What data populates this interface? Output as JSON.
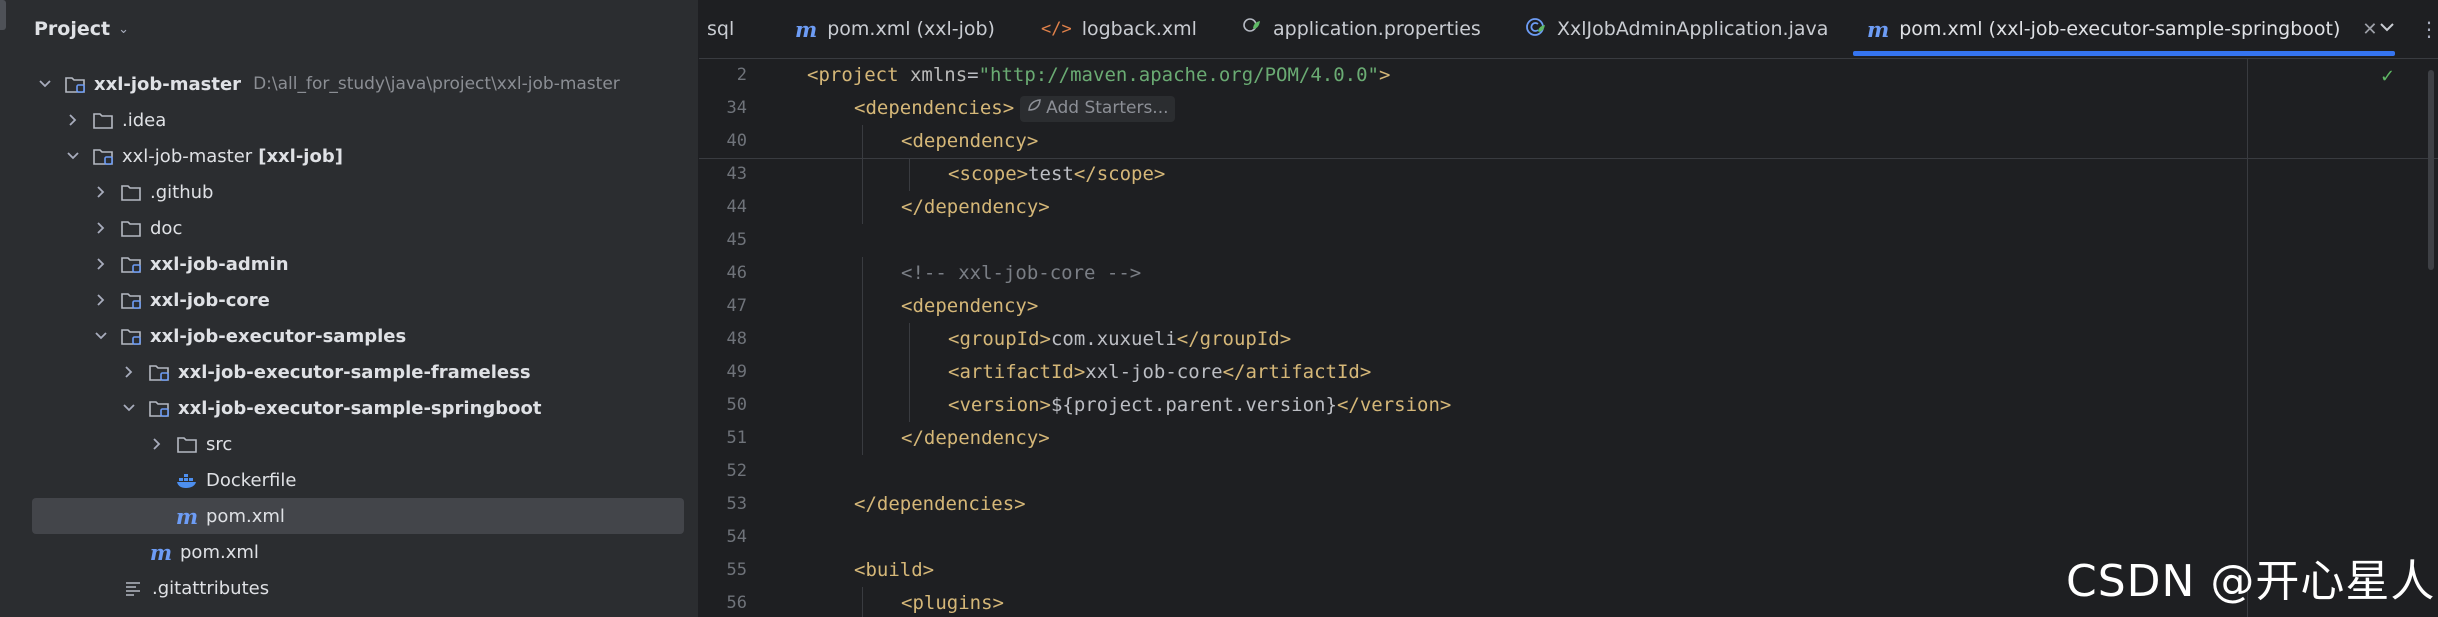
{
  "project_panel": {
    "title": "Project",
    "tree": [
      {
        "label": "xxl-job-master",
        "path": "D:\\all_for_study\\java\\project\\xxl-job-master",
        "bold": true
      },
      {
        "label": ".idea"
      },
      {
        "label": "xxl-job-master",
        "suffix": "[xxl-job]"
      },
      {
        "label": ".github"
      },
      {
        "label": "doc"
      },
      {
        "label": "xxl-job-admin",
        "bold": true
      },
      {
        "label": "xxl-job-core",
        "bold": true
      },
      {
        "label": "xxl-job-executor-samples",
        "bold": true
      },
      {
        "label": "xxl-job-executor-sample-frameless",
        "bold": true
      },
      {
        "label": "xxl-job-executor-sample-springboot",
        "bold": true
      },
      {
        "label": "src"
      },
      {
        "label": "Dockerfile"
      },
      {
        "label": "pom.xml",
        "selected": true
      },
      {
        "label": "pom.xml"
      },
      {
        "label": ".gitattributes"
      }
    ]
  },
  "tabs": [
    {
      "label": "sql"
    },
    {
      "label": "pom.xml (xxl-job)",
      "icon": "maven-icon"
    },
    {
      "label": "logback.xml",
      "icon": "xml-code-icon"
    },
    {
      "label": "application.properties",
      "icon": "spring-properties-icon"
    },
    {
      "label": "XxlJobAdminApplication.java",
      "icon": "spring-java-class-icon"
    },
    {
      "label": "pom.xml (xxl-job-executor-sample-springboot)",
      "icon": "maven-icon",
      "active": true
    }
  ],
  "editor": {
    "hint_label": "Add Starters...",
    "lines": [
      {
        "num": "2",
        "indent": 0,
        "parts": [
          [
            "tag",
            "<project "
          ],
          [
            "attr",
            "xmlns"
          ],
          [
            "txt",
            "="
          ],
          [
            "str",
            "\"http://maven.apache.org/POM/4.0.0\""
          ],
          [
            "tag",
            ">"
          ]
        ]
      },
      {
        "num": "34",
        "indent": 1,
        "hint": true,
        "parts": [
          [
            "tag",
            "<dependencies>"
          ]
        ]
      },
      {
        "num": "40",
        "indent": 2,
        "parts": [
          [
            "tag",
            "<dependency>"
          ]
        ]
      },
      {
        "num": "43",
        "indent": 3,
        "parts": [
          [
            "tag",
            "<scope>"
          ],
          [
            "txt",
            "test"
          ],
          [
            "tag",
            "</scope>"
          ]
        ]
      },
      {
        "num": "44",
        "indent": 2,
        "parts": [
          [
            "tag",
            "</dependency>"
          ]
        ]
      },
      {
        "num": "45",
        "indent": 0,
        "parts": []
      },
      {
        "num": "46",
        "indent": 2,
        "parts": [
          [
            "cmt",
            "<!-- xxl-job-core -->"
          ]
        ]
      },
      {
        "num": "47",
        "indent": 2,
        "parts": [
          [
            "tag",
            "<dependency>"
          ]
        ]
      },
      {
        "num": "48",
        "indent": 3,
        "parts": [
          [
            "tag",
            "<groupId>"
          ],
          [
            "txt",
            "com.xuxueli"
          ],
          [
            "tag",
            "</groupId>"
          ]
        ]
      },
      {
        "num": "49",
        "indent": 3,
        "parts": [
          [
            "tag",
            "<artifactId>"
          ],
          [
            "txt",
            "xxl-job-core"
          ],
          [
            "tag",
            "</artifactId>"
          ]
        ]
      },
      {
        "num": "50",
        "indent": 3,
        "parts": [
          [
            "tag",
            "<version>"
          ],
          [
            "txt",
            "${project.parent.version}"
          ],
          [
            "tag",
            "</version>"
          ]
        ]
      },
      {
        "num": "51",
        "indent": 2,
        "parts": [
          [
            "tag",
            "</dependency>"
          ]
        ]
      },
      {
        "num": "52",
        "indent": 0,
        "parts": []
      },
      {
        "num": "53",
        "indent": 1,
        "parts": [
          [
            "tag",
            "</dependencies>"
          ]
        ]
      },
      {
        "num": "54",
        "indent": 0,
        "parts": []
      },
      {
        "num": "55",
        "indent": 1,
        "parts": [
          [
            "tag",
            "<build>"
          ]
        ]
      },
      {
        "num": "56",
        "indent": 2,
        "parts": [
          [
            "tag",
            "<plugins>"
          ]
        ]
      }
    ]
  },
  "watermark": "CSDN @开心星人",
  "colors": {
    "accent": "#3574f0",
    "maven_icon": "#6d9cf5",
    "xml_tag": "#d5b778",
    "string": "#6aab73",
    "comment": "#7a7e85"
  }
}
